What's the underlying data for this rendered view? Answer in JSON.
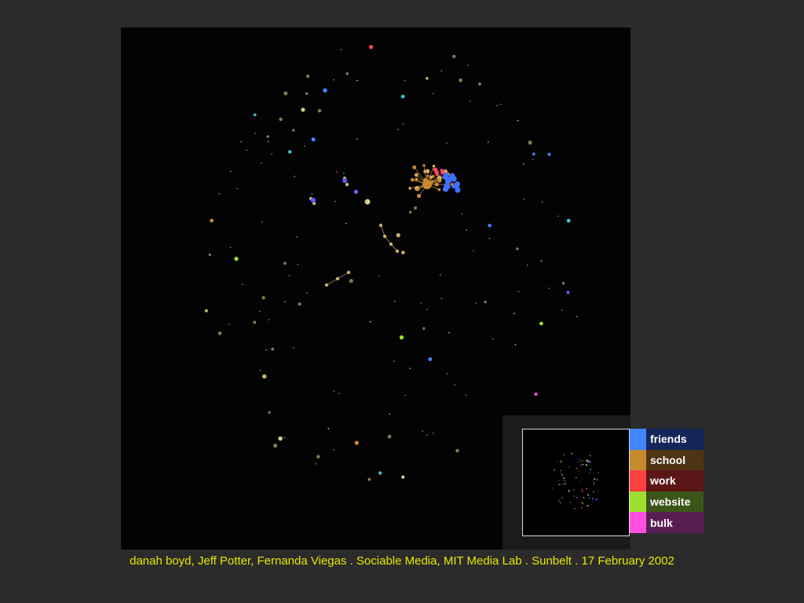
{
  "legend": {
    "items": [
      {
        "label": "friends",
        "swatch": "#3f86ff",
        "bg": "#15275a"
      },
      {
        "label": "school",
        "swatch": "#c88a2f",
        "bg": "#4f3413"
      },
      {
        "label": "work",
        "swatch": "#ff4040",
        "bg": "#5b1616"
      },
      {
        "label": "website",
        "swatch": "#9ee030",
        "bg": "#3b5618"
      },
      {
        "label": "bulk",
        "swatch": "#ff50e0",
        "bg": "#591f55"
      }
    ]
  },
  "caption": {
    "text": "danah boyd, Jeff Potter, Fernanda Viegas . Sociable Media, MIT Media Lab . Sunbelt . 17 February 2002"
  },
  "colors": {
    "background": "#2b2b2b",
    "canvas": "#030303",
    "caption": "#e8e800"
  }
}
